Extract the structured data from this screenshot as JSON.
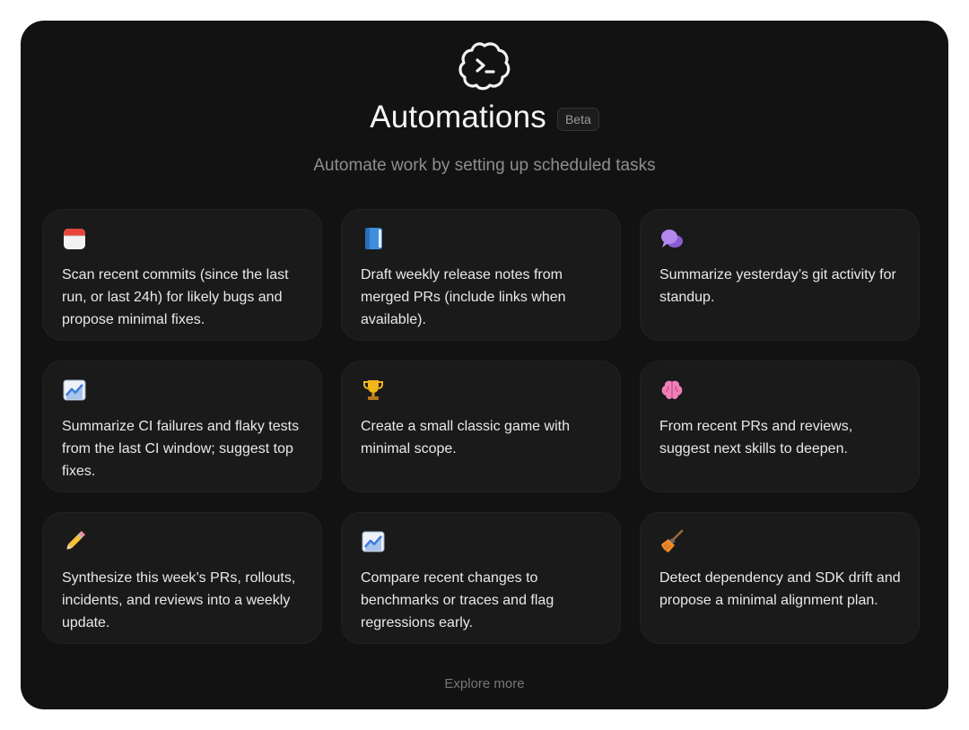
{
  "header": {
    "title": "Automations",
    "badge": "Beta",
    "subtitle": "Automate work by setting up scheduled tasks",
    "logo_icon": "terminal-cloud-icon"
  },
  "cards": [
    {
      "icon": "calendar-icon",
      "text": "Scan recent commits (since the last run, or last 24h) for likely bugs and propose minimal fixes."
    },
    {
      "icon": "book-icon",
      "text": "Draft weekly release notes from merged PRs (include links when available)."
    },
    {
      "icon": "speech-bubble-icon",
      "text": "Summarize yesterday’s git activity for standup."
    },
    {
      "icon": "chart-icon",
      "text": "Summarize CI failures and flaky tests from the last CI window; suggest top fixes."
    },
    {
      "icon": "trophy-icon",
      "text": "Create a small classic game with minimal scope."
    },
    {
      "icon": "brain-icon",
      "text": "From recent PRs and reviews, suggest next skills to deepen."
    },
    {
      "icon": "pencil-icon",
      "text": "Synthesize this week’s PRs, rollouts, incidents, and reviews into a weekly update."
    },
    {
      "icon": "chart-icon",
      "text": "Compare recent changes to benchmarks or traces and flag regressions early."
    },
    {
      "icon": "broom-icon",
      "text": "Detect dependency and SDK drift and propose a minimal alignment plan."
    }
  ],
  "footer": {
    "explore_label": "Explore more"
  }
}
